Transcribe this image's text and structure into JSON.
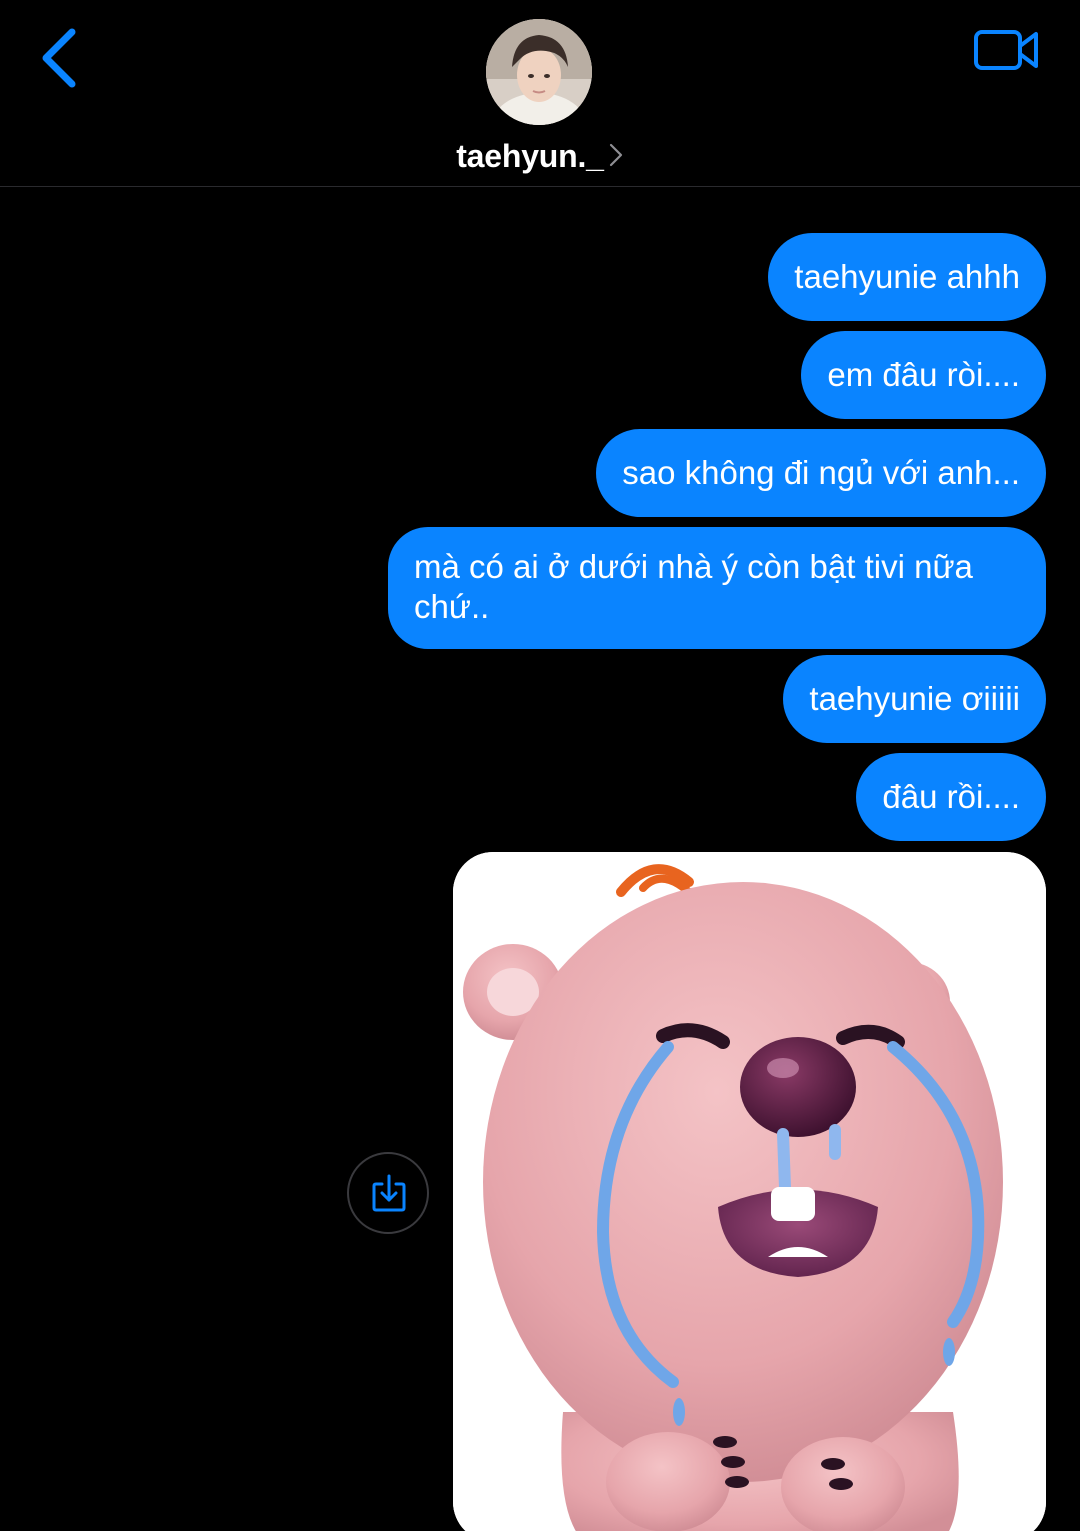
{
  "header": {
    "contact_name": "taehyun._",
    "back_icon": "chevron-left-icon",
    "video_icon": "video-camera-icon",
    "accent_color": "#0a84ff"
  },
  "messages": [
    {
      "text": "taehyunie ahhh",
      "sender": "me"
    },
    {
      "text": "em đâu ròi....",
      "sender": "me"
    },
    {
      "text": "sao không đi ngủ với anh...",
      "sender": "me"
    },
    {
      "text": "mà có ai ở dưới nhà ý còn bật tivi nữa chứ..",
      "sender": "me"
    },
    {
      "text": "taehyunie ơiiiii",
      "sender": "me"
    },
    {
      "text": "đâu rồi....",
      "sender": "me"
    }
  ],
  "image_message": {
    "content": "crying pink beaver sticker",
    "save_icon": "save-download-icon"
  },
  "colors": {
    "background": "#000000",
    "bubble": "#0a84ff",
    "text": "#ffffff"
  }
}
